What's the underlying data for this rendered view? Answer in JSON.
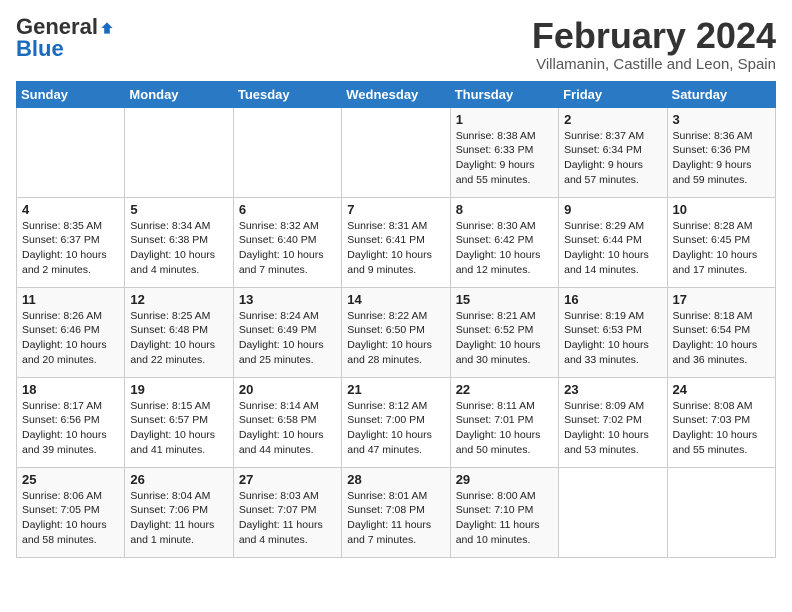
{
  "logo": {
    "general": "General",
    "blue": "Blue"
  },
  "header": {
    "title": "February 2024",
    "subtitle": "Villamanin, Castille and Leon, Spain"
  },
  "weekdays": [
    "Sunday",
    "Monday",
    "Tuesday",
    "Wednesday",
    "Thursday",
    "Friday",
    "Saturday"
  ],
  "weeks": [
    [
      {
        "day": "",
        "info": ""
      },
      {
        "day": "",
        "info": ""
      },
      {
        "day": "",
        "info": ""
      },
      {
        "day": "",
        "info": ""
      },
      {
        "day": "1",
        "info": "Sunrise: 8:38 AM\nSunset: 6:33 PM\nDaylight: 9 hours\nand 55 minutes."
      },
      {
        "day": "2",
        "info": "Sunrise: 8:37 AM\nSunset: 6:34 PM\nDaylight: 9 hours\nand 57 minutes."
      },
      {
        "day": "3",
        "info": "Sunrise: 8:36 AM\nSunset: 6:36 PM\nDaylight: 9 hours\nand 59 minutes."
      }
    ],
    [
      {
        "day": "4",
        "info": "Sunrise: 8:35 AM\nSunset: 6:37 PM\nDaylight: 10 hours\nand 2 minutes."
      },
      {
        "day": "5",
        "info": "Sunrise: 8:34 AM\nSunset: 6:38 PM\nDaylight: 10 hours\nand 4 minutes."
      },
      {
        "day": "6",
        "info": "Sunrise: 8:32 AM\nSunset: 6:40 PM\nDaylight: 10 hours\nand 7 minutes."
      },
      {
        "day": "7",
        "info": "Sunrise: 8:31 AM\nSunset: 6:41 PM\nDaylight: 10 hours\nand 9 minutes."
      },
      {
        "day": "8",
        "info": "Sunrise: 8:30 AM\nSunset: 6:42 PM\nDaylight: 10 hours\nand 12 minutes."
      },
      {
        "day": "9",
        "info": "Sunrise: 8:29 AM\nSunset: 6:44 PM\nDaylight: 10 hours\nand 14 minutes."
      },
      {
        "day": "10",
        "info": "Sunrise: 8:28 AM\nSunset: 6:45 PM\nDaylight: 10 hours\nand 17 minutes."
      }
    ],
    [
      {
        "day": "11",
        "info": "Sunrise: 8:26 AM\nSunset: 6:46 PM\nDaylight: 10 hours\nand 20 minutes."
      },
      {
        "day": "12",
        "info": "Sunrise: 8:25 AM\nSunset: 6:48 PM\nDaylight: 10 hours\nand 22 minutes."
      },
      {
        "day": "13",
        "info": "Sunrise: 8:24 AM\nSunset: 6:49 PM\nDaylight: 10 hours\nand 25 minutes."
      },
      {
        "day": "14",
        "info": "Sunrise: 8:22 AM\nSunset: 6:50 PM\nDaylight: 10 hours\nand 28 minutes."
      },
      {
        "day": "15",
        "info": "Sunrise: 8:21 AM\nSunset: 6:52 PM\nDaylight: 10 hours\nand 30 minutes."
      },
      {
        "day": "16",
        "info": "Sunrise: 8:19 AM\nSunset: 6:53 PM\nDaylight: 10 hours\nand 33 minutes."
      },
      {
        "day": "17",
        "info": "Sunrise: 8:18 AM\nSunset: 6:54 PM\nDaylight: 10 hours\nand 36 minutes."
      }
    ],
    [
      {
        "day": "18",
        "info": "Sunrise: 8:17 AM\nSunset: 6:56 PM\nDaylight: 10 hours\nand 39 minutes."
      },
      {
        "day": "19",
        "info": "Sunrise: 8:15 AM\nSunset: 6:57 PM\nDaylight: 10 hours\nand 41 minutes."
      },
      {
        "day": "20",
        "info": "Sunrise: 8:14 AM\nSunset: 6:58 PM\nDaylight: 10 hours\nand 44 minutes."
      },
      {
        "day": "21",
        "info": "Sunrise: 8:12 AM\nSunset: 7:00 PM\nDaylight: 10 hours\nand 47 minutes."
      },
      {
        "day": "22",
        "info": "Sunrise: 8:11 AM\nSunset: 7:01 PM\nDaylight: 10 hours\nand 50 minutes."
      },
      {
        "day": "23",
        "info": "Sunrise: 8:09 AM\nSunset: 7:02 PM\nDaylight: 10 hours\nand 53 minutes."
      },
      {
        "day": "24",
        "info": "Sunrise: 8:08 AM\nSunset: 7:03 PM\nDaylight: 10 hours\nand 55 minutes."
      }
    ],
    [
      {
        "day": "25",
        "info": "Sunrise: 8:06 AM\nSunset: 7:05 PM\nDaylight: 10 hours\nand 58 minutes."
      },
      {
        "day": "26",
        "info": "Sunrise: 8:04 AM\nSunset: 7:06 PM\nDaylight: 11 hours\nand 1 minute."
      },
      {
        "day": "27",
        "info": "Sunrise: 8:03 AM\nSunset: 7:07 PM\nDaylight: 11 hours\nand 4 minutes."
      },
      {
        "day": "28",
        "info": "Sunrise: 8:01 AM\nSunset: 7:08 PM\nDaylight: 11 hours\nand 7 minutes."
      },
      {
        "day": "29",
        "info": "Sunrise: 8:00 AM\nSunset: 7:10 PM\nDaylight: 11 hours\nand 10 minutes."
      },
      {
        "day": "",
        "info": ""
      },
      {
        "day": "",
        "info": ""
      }
    ]
  ]
}
